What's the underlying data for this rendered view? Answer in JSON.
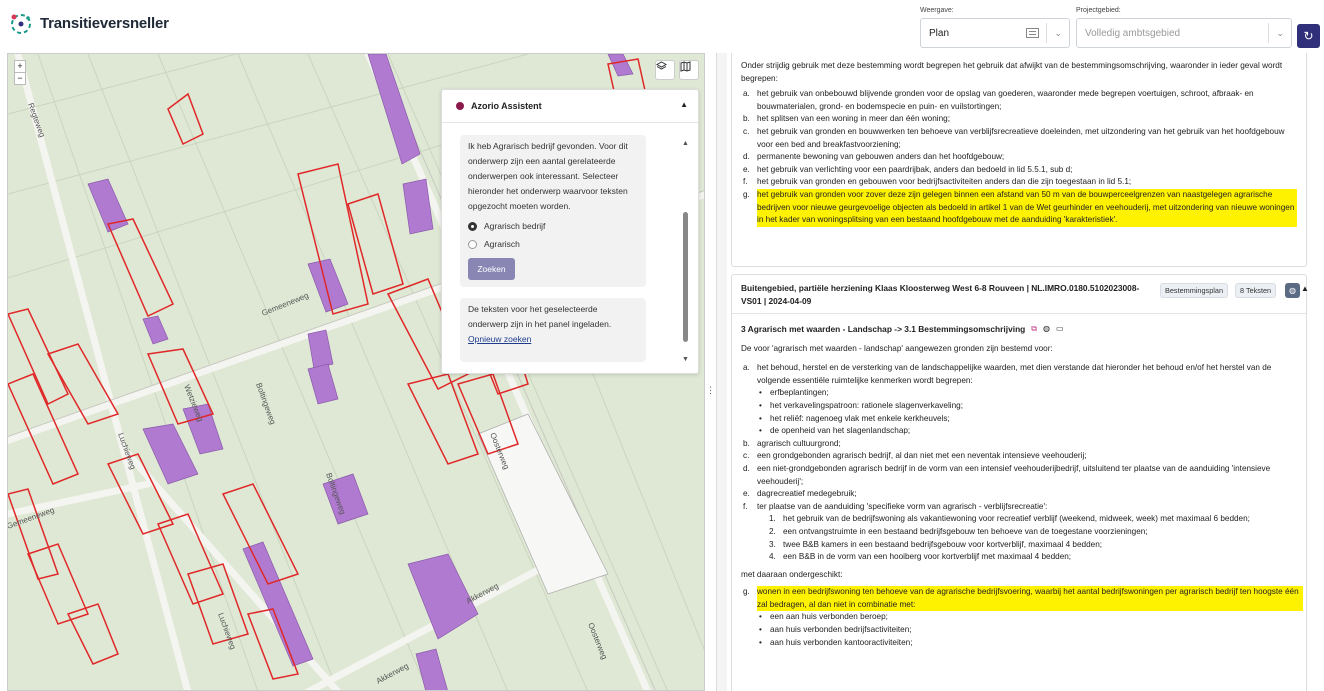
{
  "app": {
    "title": "Transitieversneller"
  },
  "controls": {
    "weergave_label": "Weergave:",
    "weergave_value": "Plan",
    "project_label": "Projectgebied:",
    "project_placeholder": "Volledig ambtsgebied"
  },
  "map": {
    "zoom_in": "+",
    "zoom_out": "−",
    "street_labels": [
      "Regteweg",
      "Gemeeneweg",
      "Boltingeweg",
      "Oosterweg",
      "Luchieweg",
      "Akkerweg",
      "Boltingeweg",
      "Oosterweg",
      "Gemeeneweg",
      "Wetzieweg",
      "Luchieweg",
      "Akkerweg"
    ]
  },
  "assistant": {
    "title": "Azorio Assistent",
    "message": "Ik heb Agrarisch bedrijf gevonden. Voor dit onderwerp zijn een aantal gerelateerde onderwerpen ook interessant. Selecteer hieronder het onderwerp waarvoor teksten opgezocht moeten worden.",
    "options": [
      "Agrarisch bedrijf",
      "Agrarisch"
    ],
    "search_button": "Zoeken",
    "result_text": "De teksten voor het geselecteerde onderwerp zijn in het panel ingeladen.",
    "retry_link": "Opnieuw zoeken"
  },
  "card1": {
    "intro": "Onder strijdig gebruik met deze bestemming wordt begrepen het gebruik dat afwijkt van de bestemmingsomschrijving, waaronder in ieder geval wordt begrepen:",
    "items": [
      {
        "n": "a.",
        "t": "het gebruik van onbebouwd blijvende gronden voor de opslag van goederen, waaronder mede begrepen voertuigen, schroot, afbraak- en bouwmaterialen, grond- en bodemspecie en puin- en vuilstortingen;"
      },
      {
        "n": "b.",
        "t": "het splitsen van een woning in meer dan één woning;"
      },
      {
        "n": "c.",
        "t": "het gebruik van gronden en bouwwerken ten behoeve van verblijfsrecreatieve doeleinden, met uitzondering van het gebruik van het hoofdgebouw voor een bed and breakfastvoorziening;"
      },
      {
        "n": "d.",
        "t": "permanente bewoning van gebouwen anders dan het hoofdgebouw;"
      },
      {
        "n": "e.",
        "t": "het gebruik van verlichting voor een paardrijbak, anders dan bedoeld in lid 5.5.1, sub d;"
      },
      {
        "n": "f.",
        "t": "het gebruik van gronden en gebouwen voor bedrijfsactiviteiten anders dan die zijn toegestaan in lid 5.1;"
      },
      {
        "n": "g.",
        "t": "het gebruik van gronden voor zover deze zijn gelegen binnen een afstand van 50 m van de bouwperceelgrenzen van naastgelegen agrarische bedrijven voor nieuwe geurgevoelige objecten als bedoeld in artikel 1 van de Wet geurhinder en veehouderij, met uitzondering van nieuwe woningen in het kader van woningsplitsing van een bestaand hoofdgebouw met de aanduiding 'karakteristiek'."
      }
    ]
  },
  "card2": {
    "title": "Buitengebied, partiële herziening Klaas Kloosterweg West 6-8 Rouveen | NL.IMRO.0180.5102023008-VS01 | 2024-04-09",
    "badge_type": "Bestemmingsplan",
    "badge_count": "8 Teksten",
    "section": "3 Agrarisch met waarden - Landschap -> 3.1 Bestemmingsomschrijving",
    "intro": "De voor 'agrarisch met waarden - landschap' aangewezen gronden zijn bestemd voor:",
    "item_a": "het behoud, herstel en de versterking van de landschappelijke waarden, met dien verstande dat hieronder het behoud en/of het herstel van de volgende essentiële ruimtelijke kenmerken wordt begrepen:",
    "bullets_a": [
      "erfbeplantingen;",
      "het verkavelingspatroon: rationele slagenverkaveling;",
      "het reliëf: nagenoeg vlak met enkele kerkheuvels;",
      "de openheid van het slagenlandschap;"
    ],
    "item_b": "agrarisch cultuurgrond;",
    "item_c": "een grondgebonden agrarisch bedrijf, al dan niet met een neventak intensieve veehouderij;",
    "item_d": "een niet-grondgebonden agrarisch bedrijf in de vorm van een intensief veehouderijbedrijf, uitsluitend ter plaatse van de aanduiding 'intensieve veehouderij';",
    "item_e": "dagrecreatief medegebruik;",
    "item_f": "ter plaatse van de aanduiding 'specifieke vorm van agrarisch - verblijfsrecreatie':",
    "sub_f": [
      "het gebruik van de bedrijfswoning als vakantiewoning voor recreatief verblijf (weekend, midweek, week) met maximaal 6 bedden;",
      "een ontvangstruimte in een bestaand bedrijfsgebouw ten behoeve van de toegestane voorzieningen;",
      "twee B&B kamers in een bestaand bedrijfsgebouw voor kortverblijf, maximaal 4 bedden;",
      "een B&B in de vorm van een hooiberg voor kortverblijf met maximaal 4 bedden;"
    ],
    "outro": "met daaraan ondergeschikt:",
    "item_g": "wonen in een bedrijfswoning ten behoeve van de agrarische bedrijfsvoering, waarbij het aantal bedrijfswoningen per agrarisch bedrijf ten hoogste één zal bedragen, al dan niet in combinatie met:",
    "bullets_g": [
      "een aan huis verbonden beroep;",
      "aan huis verbonden bedrijfsactiviteiten;",
      "aan huis verbonden kantooractiviteiten;"
    ]
  }
}
